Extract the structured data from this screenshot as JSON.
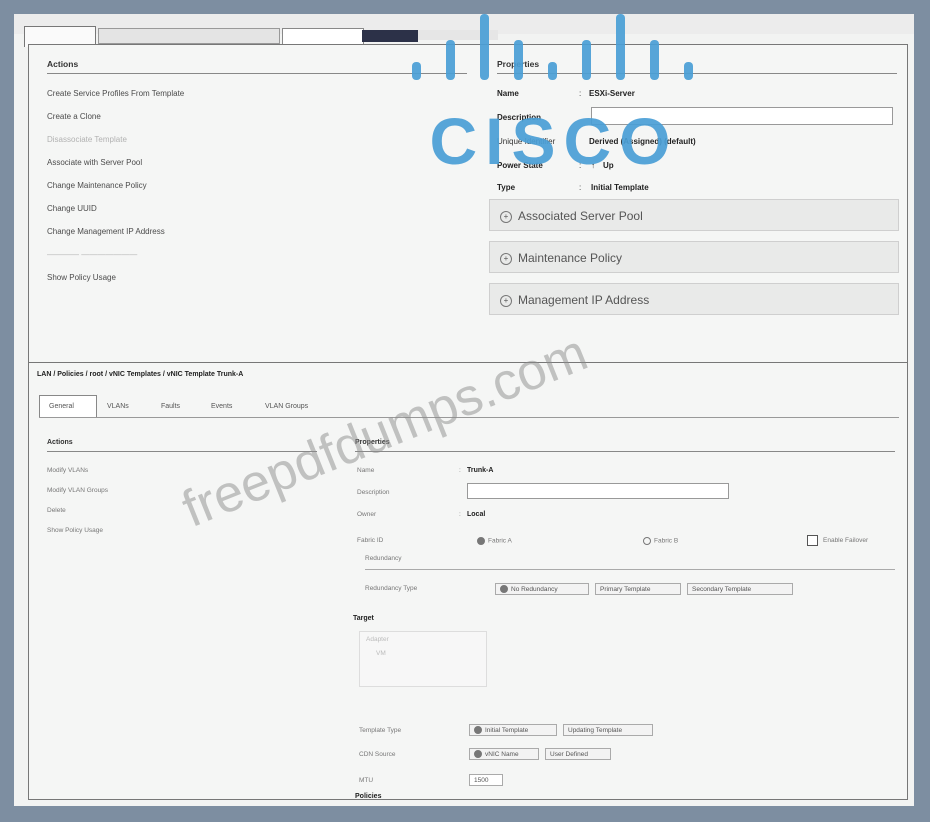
{
  "top": {
    "actions_title": "Actions",
    "properties_title": "Properties",
    "actions": [
      {
        "label": "Create Service Profiles From Template",
        "disabled": false
      },
      {
        "label": "Create a Clone",
        "disabled": false
      },
      {
        "label": "Disassociate Template",
        "disabled": true
      },
      {
        "label": "Associate with Server Pool",
        "disabled": false
      },
      {
        "label": "Change Maintenance Policy",
        "disabled": false
      },
      {
        "label": "Change UUID",
        "disabled": false
      },
      {
        "label": "Change Management IP Address",
        "disabled": false
      },
      {
        "label": "Show Policy Usage",
        "disabled": false
      }
    ],
    "props": {
      "name_label": "Name",
      "name_value": "ESXi-Server",
      "description_label": "Description",
      "unique_label": "Unique Identifier",
      "unique_value": "Derived (Assigned) (default)",
      "power_label": "Power State",
      "power_value": "Up",
      "type_label": "Type",
      "type_value": "Initial Template"
    },
    "sections": [
      "Associated Server Pool",
      "Maintenance Policy",
      "Management IP Address"
    ]
  },
  "bottom": {
    "breadcrumb": "LAN / Policies / root / vNIC Templates / vNIC Template Trunk-A",
    "tabs": [
      "General",
      "VLANs",
      "Faults",
      "Events",
      "VLAN Groups"
    ],
    "actions_title": "Actions",
    "actions": [
      {
        "label": "Modify VLANs",
        "disabled": false
      },
      {
        "label": "Modify VLAN Groups",
        "disabled": false
      },
      {
        "label": "Delete",
        "disabled": false
      },
      {
        "label": "Show Policy Usage",
        "disabled": false
      }
    ],
    "properties_title": "Properties",
    "props": {
      "name_label": "Name",
      "name_value": "Trunk-A",
      "description_label": "Description",
      "owner_label": "Owner",
      "owner_value": "Local",
      "fabric_label": "Fabric ID",
      "fabric_a": "Fabric A",
      "fabric_b": "Fabric B",
      "enable_failover": "Enable Failover",
      "redundancy_label": "Redundancy",
      "redundancy_type_label": "Redundancy Type",
      "redundancy_options": [
        "No Redundancy",
        "Primary Template",
        "Secondary Template"
      ],
      "target_label": "Target",
      "target_options": [
        "Adapter",
        "VM"
      ],
      "template_type_label": "Template Type",
      "template_type_options": [
        "Initial Template",
        "Updating Template"
      ],
      "cdn_source_label": "CDN Source",
      "cdn_source_options": [
        "vNIC Name",
        "User Defined"
      ],
      "mtu_label": "MTU",
      "mtu_value": "1500",
      "policies_label": "Policies"
    }
  },
  "watermark": {
    "logo_text": "CISCO",
    "text": "freepdfdumps.com"
  },
  "colors": {
    "logo": "#4a9fd6",
    "frame": "#7d8ea1",
    "panel": "#f5f6f5"
  }
}
